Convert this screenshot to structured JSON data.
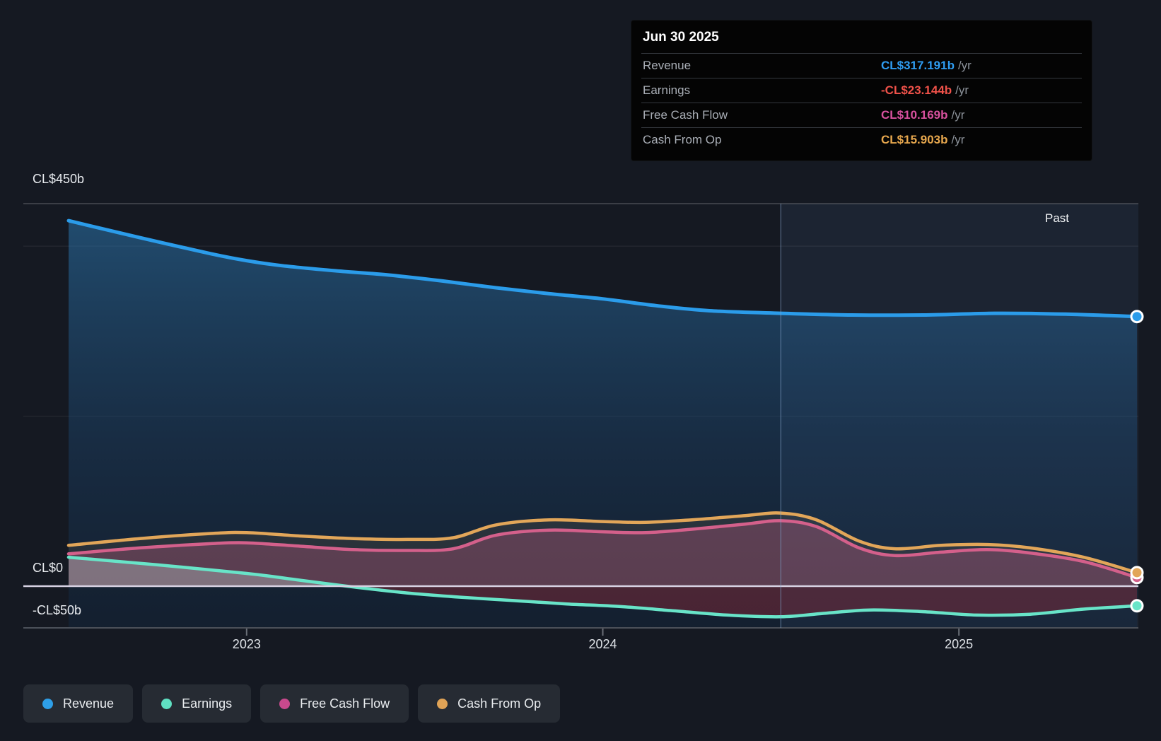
{
  "past_label": "Past",
  "tooltip": {
    "date": "Jun 30 2025",
    "rows": [
      {
        "label": "Revenue",
        "value": "CL$317.191b",
        "suffix": "/yr",
        "color": "#2f9df2"
      },
      {
        "label": "Earnings",
        "value": "-CL$23.144b",
        "suffix": "/yr",
        "color": "#f0524a"
      },
      {
        "label": "Free Cash Flow",
        "value": "CL$10.169b",
        "suffix": "/yr",
        "color": "#d8519e"
      },
      {
        "label": "Cash From Op",
        "value": "CL$15.903b",
        "suffix": "/yr",
        "color": "#e8a84e"
      }
    ]
  },
  "y_axis": {
    "labels": [
      {
        "text": "CL$450b",
        "value": 450
      },
      {
        "text": "CL$0",
        "value": 0
      },
      {
        "text": "-CL$50b",
        "value": -50
      }
    ],
    "minor_gridlines": [
      400,
      200
    ]
  },
  "x_axis": {
    "labels": [
      {
        "text": "2023",
        "t": 2023.0
      },
      {
        "text": "2024",
        "t": 2024.0
      },
      {
        "text": "2025",
        "t": 2025.0
      }
    ]
  },
  "divider": {
    "t": 2024.5
  },
  "legend": [
    {
      "label": "Revenue",
      "color": "#2e9fe8"
    },
    {
      "label": "Earnings",
      "color": "#5fe0c2"
    },
    {
      "label": "Free Cash Flow",
      "color": "#c9498d"
    },
    {
      "label": "Cash From Op",
      "color": "#e0a356"
    }
  ],
  "chart_data": {
    "type": "area",
    "x_unit": "decimal_year",
    "x_range": [
      2022.5,
      2025.5
    ],
    "y_unit": "CL$ billions",
    "ylim": [
      -50,
      450
    ],
    "grid": "partial",
    "legend_position": "bottom",
    "annotations": [
      "Past region highlighted right of Jun 30 2024 divider"
    ],
    "series": [
      {
        "name": "Revenue",
        "color": "#2b9cea",
        "points": [
          [
            2022.5,
            430
          ],
          [
            2022.7,
            410
          ],
          [
            2022.9,
            391
          ],
          [
            2023.0,
            383
          ],
          [
            2023.1,
            377
          ],
          [
            2023.25,
            371
          ],
          [
            2023.4,
            366
          ],
          [
            2023.55,
            359
          ],
          [
            2023.7,
            351
          ],
          [
            2023.85,
            344
          ],
          [
            2024.0,
            338
          ],
          [
            2024.15,
            330
          ],
          [
            2024.3,
            324
          ],
          [
            2024.5,
            321
          ],
          [
            2024.7,
            319
          ],
          [
            2024.9,
            319
          ],
          [
            2025.1,
            321
          ],
          [
            2025.3,
            320
          ],
          [
            2025.5,
            317.191
          ]
        ]
      },
      {
        "name": "Earnings",
        "color": "#68e4c8",
        "points": [
          [
            2022.5,
            34
          ],
          [
            2022.75,
            25
          ],
          [
            2023.0,
            15
          ],
          [
            2023.15,
            7
          ],
          [
            2023.3,
            -1
          ],
          [
            2023.45,
            -8
          ],
          [
            2023.6,
            -13
          ],
          [
            2023.75,
            -17
          ],
          [
            2023.9,
            -21
          ],
          [
            2024.05,
            -24
          ],
          [
            2024.2,
            -29
          ],
          [
            2024.35,
            -34
          ],
          [
            2024.5,
            -36
          ],
          [
            2024.62,
            -32
          ],
          [
            2024.75,
            -28
          ],
          [
            2024.9,
            -30
          ],
          [
            2025.05,
            -34
          ],
          [
            2025.2,
            -33
          ],
          [
            2025.35,
            -27
          ],
          [
            2025.5,
            -23.144
          ]
        ]
      },
      {
        "name": "Free Cash Flow",
        "color": "#d4608b",
        "points": [
          [
            2022.5,
            38
          ],
          [
            2022.7,
            45
          ],
          [
            2022.9,
            50
          ],
          [
            2023.0,
            51
          ],
          [
            2023.15,
            47
          ],
          [
            2023.3,
            43
          ],
          [
            2023.45,
            42
          ],
          [
            2023.58,
            44
          ],
          [
            2023.7,
            60
          ],
          [
            2023.85,
            66
          ],
          [
            2024.0,
            64
          ],
          [
            2024.12,
            63
          ],
          [
            2024.25,
            67
          ],
          [
            2024.4,
            73
          ],
          [
            2024.5,
            77
          ],
          [
            2024.6,
            70
          ],
          [
            2024.72,
            45
          ],
          [
            2024.82,
            36
          ],
          [
            2024.95,
            40
          ],
          [
            2025.08,
            43
          ],
          [
            2025.2,
            39
          ],
          [
            2025.35,
            29
          ],
          [
            2025.5,
            10.169
          ]
        ]
      },
      {
        "name": "Cash From Op",
        "color": "#e2a659",
        "points": [
          [
            2022.5,
            48
          ],
          [
            2022.7,
            56
          ],
          [
            2022.9,
            62
          ],
          [
            2023.0,
            63
          ],
          [
            2023.15,
            59
          ],
          [
            2023.3,
            56
          ],
          [
            2023.45,
            55
          ],
          [
            2023.58,
            57
          ],
          [
            2023.7,
            72
          ],
          [
            2023.85,
            78
          ],
          [
            2024.0,
            76
          ],
          [
            2024.12,
            75
          ],
          [
            2024.25,
            78
          ],
          [
            2024.4,
            83
          ],
          [
            2024.5,
            86
          ],
          [
            2024.6,
            78
          ],
          [
            2024.72,
            53
          ],
          [
            2024.82,
            44
          ],
          [
            2024.95,
            48
          ],
          [
            2025.08,
            49
          ],
          [
            2025.2,
            45
          ],
          [
            2025.35,
            34
          ],
          [
            2025.5,
            15.903
          ]
        ]
      }
    ]
  }
}
